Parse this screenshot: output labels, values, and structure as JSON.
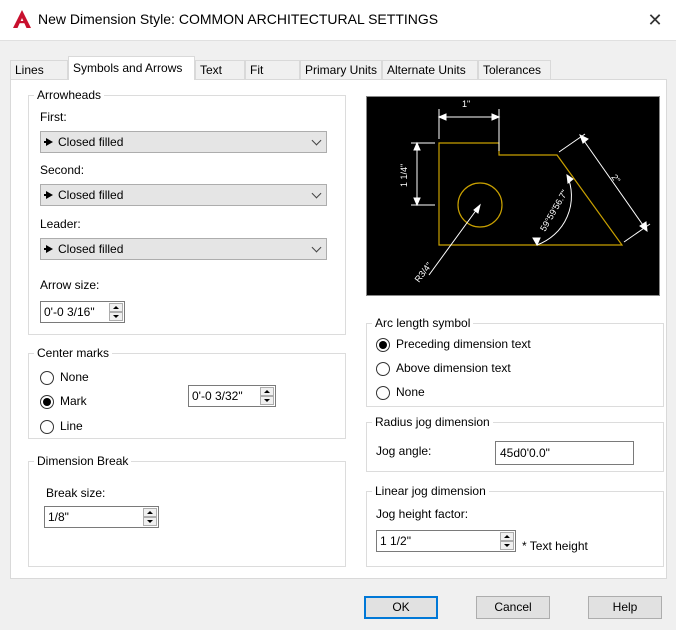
{
  "window": {
    "title": "New Dimension Style: COMMON ARCHITECTURAL SETTINGS",
    "close_glyph": "✕",
    "app_icon": "autocad-icon"
  },
  "tabs": [
    {
      "label": "Lines",
      "active": false
    },
    {
      "label": "Symbols and Arrows",
      "active": true
    },
    {
      "label": "Text",
      "active": false
    },
    {
      "label": "Fit",
      "active": false
    },
    {
      "label": "Primary Units",
      "active": false
    },
    {
      "label": "Alternate Units",
      "active": false
    },
    {
      "label": "Tolerances",
      "active": false
    }
  ],
  "arrowheads": {
    "title": "Arrowheads",
    "first_label": "First:",
    "first_value": "Closed filled",
    "second_label": "Second:",
    "second_value": "Closed filled",
    "leader_label": "Leader:",
    "leader_value": "Closed filled",
    "arrow_size_label": "Arrow size:",
    "arrow_size_value": "0'-0 3/16\""
  },
  "center_marks": {
    "title": "Center marks",
    "options": [
      "None",
      "Mark",
      "Line"
    ],
    "selected": "Mark",
    "size_value": "0'-0 3/32\""
  },
  "dimension_break": {
    "title": "Dimension Break",
    "break_size_label": "Break size:",
    "break_size_value": "1/8\""
  },
  "preview": {
    "dim_top": "1\"",
    "dim_left": "1 1/4\"",
    "dim_right": "2\"",
    "dim_angle": "59°59'56.7\"",
    "dim_radius": "R3/4\""
  },
  "arc_length": {
    "title": "Arc length symbol",
    "options": [
      "Preceding dimension text",
      "Above dimension text",
      "None"
    ],
    "selected": "Preceding dimension text"
  },
  "radius_jog": {
    "title": "Radius jog dimension",
    "jog_angle_label": "Jog angle:",
    "jog_angle_value": "45d0'0.0\""
  },
  "linear_jog": {
    "title": "Linear jog dimension",
    "height_factor_label": "Jog height factor:",
    "height_factor_value": "1 1/2\"",
    "suffix": "* Text height"
  },
  "buttons": {
    "ok": "OK",
    "cancel": "Cancel",
    "help": "Help"
  },
  "colors": {
    "accent": "#0078d7",
    "preview_bg": "#000000",
    "preview_geometry": "#c8a000",
    "preview_dims": "#ffffff",
    "app_icon": "#c8102e"
  }
}
